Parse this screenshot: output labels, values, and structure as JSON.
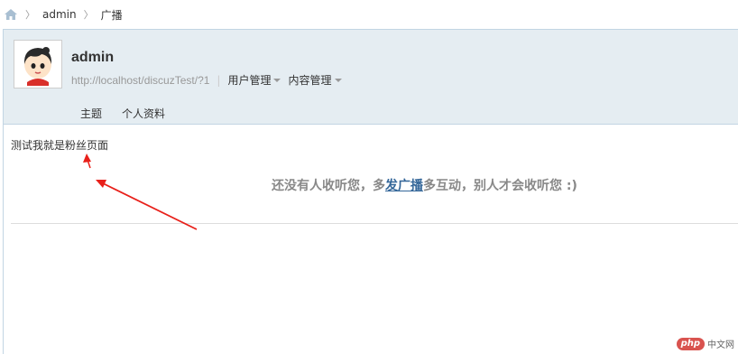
{
  "breadcrumb": {
    "home_icon": "home-icon",
    "items": [
      "admin",
      "广播"
    ]
  },
  "profile": {
    "username": "admin",
    "url": "http://localhost/discuzTest/?1",
    "menus": [
      "用户管理",
      "内容管理"
    ],
    "tabs": [
      "主题",
      "个人资料"
    ]
  },
  "content": {
    "post_text": "测试我就是粉丝页面",
    "empty_prefix": "还没有人收听您，多",
    "empty_link": "发广播",
    "empty_suffix": "多互动，别人才会收听您 :)"
  },
  "watermark": {
    "logo": "php",
    "text": "中文网"
  },
  "colors": {
    "profile_bg": "#e5edf2",
    "profile_border": "#c2d5e3",
    "link": "#336699",
    "arrow": "#e8201a"
  }
}
